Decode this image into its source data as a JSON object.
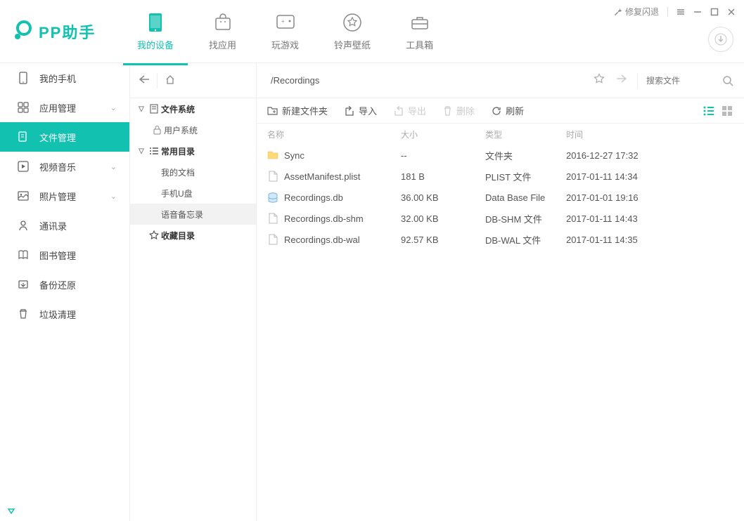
{
  "app_name": "PP助手",
  "window_controls": {
    "fix_crash": "修复闪退"
  },
  "top_nav": [
    {
      "label": "我的设备",
      "icon": "device"
    },
    {
      "label": "找应用",
      "icon": "bag"
    },
    {
      "label": "玩游戏",
      "icon": "game"
    },
    {
      "label": "铃声壁纸",
      "icon": "star"
    },
    {
      "label": "工具箱",
      "icon": "toolbox"
    }
  ],
  "top_nav_active": 0,
  "sidebar": [
    {
      "label": "我的手机",
      "icon": "phone",
      "expandable": false
    },
    {
      "label": "应用管理",
      "icon": "apps",
      "expandable": true
    },
    {
      "label": "文件管理",
      "icon": "files",
      "expandable": false
    },
    {
      "label": "视频音乐",
      "icon": "media",
      "expandable": true
    },
    {
      "label": "照片管理",
      "icon": "photo",
      "expandable": true
    },
    {
      "label": "通讯录",
      "icon": "contacts",
      "expandable": false
    },
    {
      "label": "图书管理",
      "icon": "books",
      "expandable": false
    },
    {
      "label": "备份还原",
      "icon": "backup",
      "expandable": false
    },
    {
      "label": "垃圾清理",
      "icon": "trash",
      "expandable": false
    }
  ],
  "sidebar_active": 2,
  "tree": {
    "file_system": "文件系统",
    "user_system": "用户系统",
    "common_dir": "常用目录",
    "my_docs": "我的文档",
    "phone_usb": "手机U盘",
    "voice_memo": "语音备忘录",
    "favorites": "收藏目录"
  },
  "address": {
    "path": "/Recordings",
    "search_placeholder": "搜索文件"
  },
  "toolbar": {
    "new_folder": "新建文件夹",
    "import": "导入",
    "export": "导出",
    "delete": "删除",
    "refresh": "刷新"
  },
  "columns": {
    "name": "名称",
    "size": "大小",
    "type": "类型",
    "time": "时间"
  },
  "files": [
    {
      "name": "Sync",
      "size": "--",
      "type": "文件夹",
      "time": "2016-12-27 17:32",
      "icon": "folder"
    },
    {
      "name": "AssetManifest.plist",
      "size": "181 B",
      "type": "PLIST 文件",
      "time": "2017-01-11 14:34",
      "icon": "file"
    },
    {
      "name": "Recordings.db",
      "size": "36.00 KB",
      "type": "Data Base File",
      "time": "2017-01-01 19:16",
      "icon": "db"
    },
    {
      "name": "Recordings.db-shm",
      "size": "32.00 KB",
      "type": "DB-SHM 文件",
      "time": "2017-01-11 14:43",
      "icon": "file"
    },
    {
      "name": "Recordings.db-wal",
      "size": "92.57 KB",
      "type": "DB-WAL 文件",
      "time": "2017-01-11 14:35",
      "icon": "file"
    }
  ]
}
